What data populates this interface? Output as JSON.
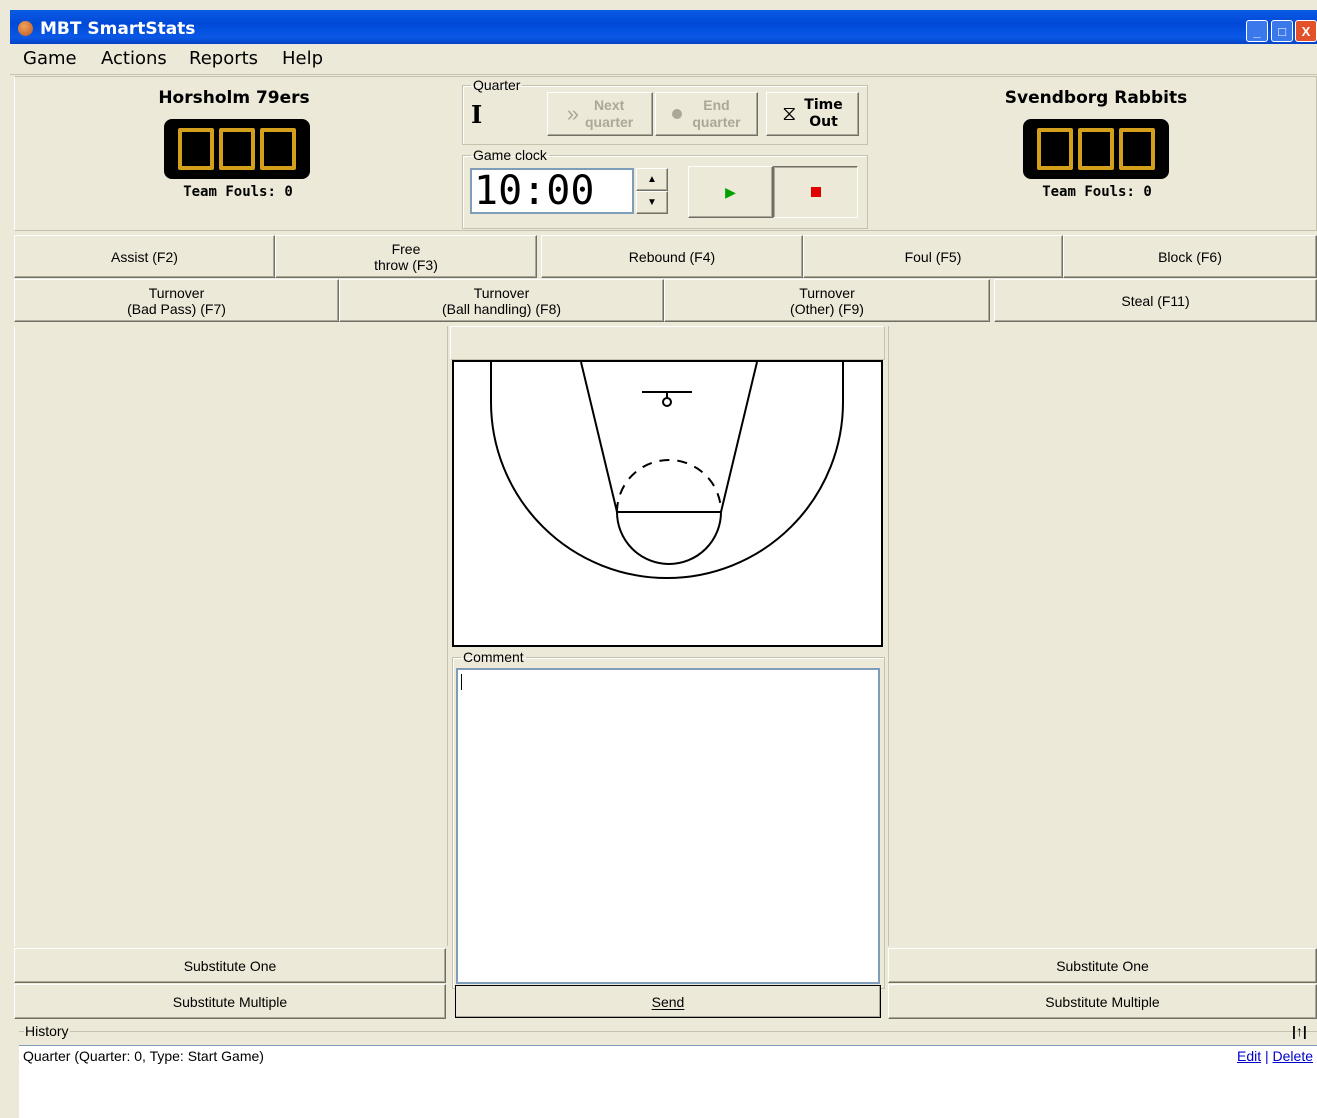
{
  "window": {
    "title": "MBT SmartStats",
    "controls": [
      "_",
      "□",
      "X"
    ]
  },
  "menu": [
    "Game",
    "Actions",
    "Reports",
    "Help"
  ],
  "home": {
    "name": "Horsholm 79ers",
    "score": "000",
    "fouls": "Team Fouls: 0"
  },
  "away": {
    "name": "Svendborg Rabbits",
    "score": "000",
    "fouls": "Team Fouls: 0"
  },
  "quarter": {
    "legend": "Quarter",
    "current": "I",
    "next_label_1": "Next",
    "next_label_2": "quarter",
    "end_label_1": "End",
    "end_label_2": "quarter",
    "timeout_label_1": "Time",
    "timeout_label_2": "Out"
  },
  "clock": {
    "legend": "Game clock",
    "value": "10:00"
  },
  "actions_row1": [
    {
      "label": "Assist (F2)"
    },
    {
      "label": "Free\nthrow (F3)"
    },
    {
      "label": "Rebound (F4)"
    },
    {
      "label": "Foul (F5)"
    },
    {
      "label": "Block (F6)"
    }
  ],
  "actions_row2": [
    {
      "label": "Turnover\n(Bad Pass) (F7)"
    },
    {
      "label": "Turnover\n(Ball handling) (F8)"
    },
    {
      "label": "Turnover\n(Other) (F9)"
    },
    {
      "label": "Steal (F11)"
    }
  ],
  "left_panel": {
    "substitute_one": "Substitute One",
    "substitute_multiple": "Substitute Multiple"
  },
  "right_panel": {
    "substitute_one": "Substitute One",
    "substitute_multiple": "Substitute Multiple"
  },
  "comment": {
    "legend": "Comment",
    "value": "",
    "send_label": "Send"
  },
  "history": {
    "legend": "History",
    "collapse_icon": "↑",
    "entries": [
      {
        "text": "Quarter (Quarter: 0, Type: Start Game)",
        "edit": "Edit",
        "separator": "|",
        "delete": "Delete"
      }
    ]
  },
  "colors": {
    "titlebar": "#0a58e6",
    "face": "#ece9d8",
    "digit": "#d4a01b",
    "play": "#00a000",
    "stop": "#e00000"
  }
}
